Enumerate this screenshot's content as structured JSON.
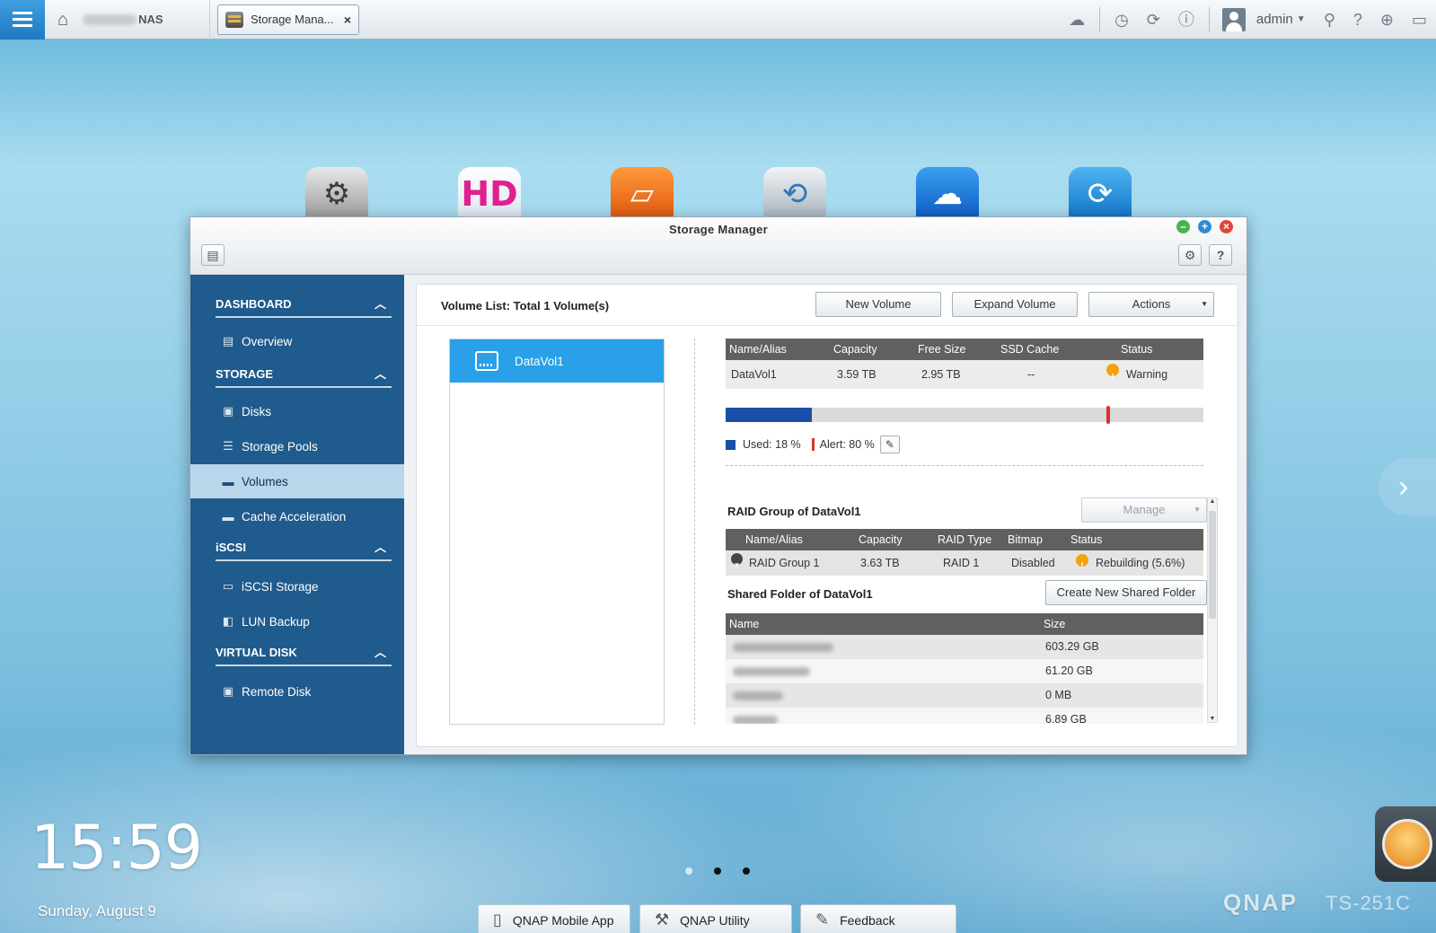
{
  "topbar": {
    "host_suffix": "NAS",
    "tab_label": "Storage Mana...",
    "tab_close": "×",
    "user": "admin"
  },
  "desktop": {
    "apps": [
      {
        "name": "settings",
        "icon": "gear-icon"
      },
      {
        "name": "hd-station",
        "icon": "hd-station-icon",
        "glyph": "HD"
      },
      {
        "name": "file-station",
        "icon": "folder-icon"
      },
      {
        "name": "backup-station",
        "icon": "backup-icon"
      },
      {
        "name": "cloud",
        "icon": "cloud-icon"
      },
      {
        "name": "sync",
        "icon": "sync-icon"
      }
    ],
    "clock": "15:59",
    "date": "Sunday, August 9",
    "dock": {
      "mobile_app": "QNAP Mobile App",
      "utility": "QNAP Utility",
      "feedback": "Feedback"
    },
    "brand": "QNAP",
    "model": "TS-251C"
  },
  "window": {
    "title": "Storage Manager"
  },
  "sidebar": {
    "sections": [
      {
        "title": "DASHBOARD",
        "items": [
          "Overview"
        ]
      },
      {
        "title": "STORAGE",
        "items": [
          "Disks",
          "Storage Pools",
          "Volumes",
          "Cache Acceleration"
        ]
      },
      {
        "title": "iSCSI",
        "items": [
          "iSCSI Storage",
          "LUN Backup"
        ]
      },
      {
        "title": "VIRTUAL DISK",
        "items": [
          "Remote Disk"
        ]
      }
    ],
    "active_item": "Volumes"
  },
  "main": {
    "volume_list_title": "Volume List: Total 1 Volume(s)",
    "buttons": {
      "new_volume": "New Volume",
      "expand_volume": "Expand Volume",
      "actions": "Actions"
    },
    "volumes": [
      "DataVol1"
    ],
    "volume_table": {
      "headers": [
        "Name/Alias",
        "Capacity",
        "Free Size",
        "SSD Cache",
        "Status"
      ],
      "row": {
        "name": "DataVol1",
        "capacity": "3.59 TB",
        "free": "2.95 TB",
        "ssd_cache": "--",
        "status": "Warning"
      }
    },
    "usage": {
      "used_percent": 18,
      "alert_percent": 80,
      "used_label": "Used: 18 %",
      "alert_label": "Alert: 80 %",
      "used_color": "#1a4fa8",
      "alert_color": "#d8332a"
    },
    "raid": {
      "title": "RAID Group of DataVol1",
      "manage": "Manage",
      "headers": [
        "Name/Alias",
        "Capacity",
        "RAID Type",
        "Bitmap",
        "Status"
      ],
      "row": {
        "name": "RAID Group 1",
        "capacity": "3.63 TB",
        "type": "RAID 1",
        "bitmap": "Disabled",
        "status": "Rebuilding (5.6%)"
      }
    },
    "shared": {
      "title": "Shared Folder of DataVol1",
      "create_button": "Create New Shared Folder",
      "headers": [
        "Name",
        "Size"
      ],
      "rows": [
        {
          "size": "603.29 GB"
        },
        {
          "size": "61.20 GB"
        },
        {
          "size": "0 MB"
        },
        {
          "size": "6.89 GB"
        }
      ]
    }
  }
}
